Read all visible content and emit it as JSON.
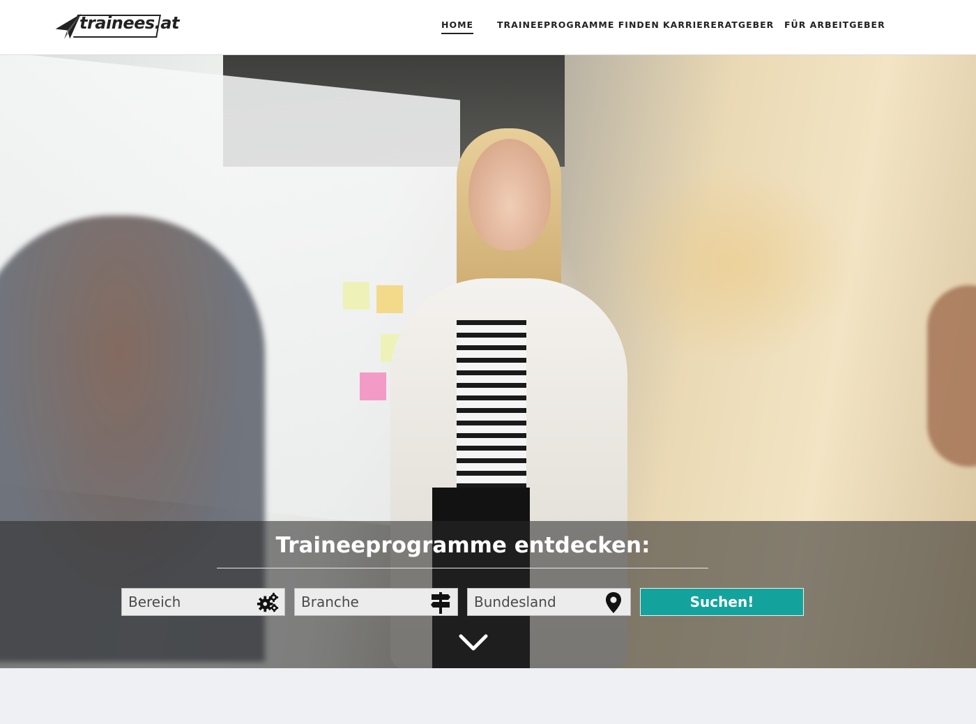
{
  "brand": {
    "logo_text": "trainees.at"
  },
  "nav": {
    "items": [
      {
        "label": "HOME",
        "active": true
      },
      {
        "label": "TRAINEEPROGRAMME FINDEN",
        "active": false
      },
      {
        "label": "KARRIERERATGEBER",
        "active": false
      },
      {
        "label": "FÜR ARBEITGEBER",
        "active": false
      }
    ]
  },
  "hero": {
    "title": "Traineeprogramme entdecken:",
    "fields": [
      {
        "label": "Bereich",
        "icon": "gears-icon"
      },
      {
        "label": "Branche",
        "icon": "signpost-icon"
      },
      {
        "label": "Bundesland",
        "icon": "map-pin-icon"
      }
    ],
    "search_label": "Suchen!",
    "scroll_icon": "chevron-down-icon"
  },
  "colors": {
    "accent": "#13a39c",
    "overlay": "rgba(40,40,40,0.55)",
    "text_dark": "#222222"
  }
}
